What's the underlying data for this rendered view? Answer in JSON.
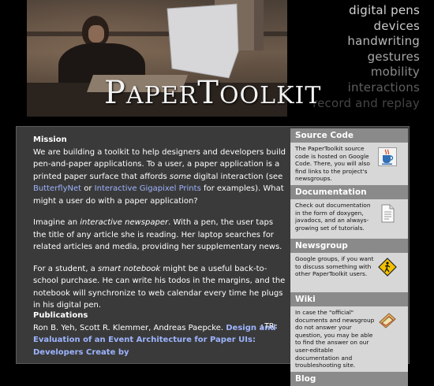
{
  "banner": {
    "logo_big_p": "P",
    "logo_small_aper": "APER",
    "logo_big_t": "T",
    "logo_small_oolkit": "OOLKIT",
    "topics": [
      {
        "label": "digital pens",
        "color": "#d2d2d2"
      },
      {
        "label": "devices",
        "color": "#c8c8c8"
      },
      {
        "label": "handwriting",
        "color": "#b8b8b8"
      },
      {
        "label": "gestures",
        "color": "#a8a8a8"
      },
      {
        "label": "mobility",
        "color": "#8c8c8c"
      },
      {
        "label": "interactions",
        "color": "#5e5e5e"
      },
      {
        "label": "record and replay",
        "color": "#454545"
      }
    ]
  },
  "main": {
    "mission_heading": "Mission",
    "mission_text_1": "We are building a toolkit to help designers and developers build pen-and-paper applications. To a user, a paper application is a printed paper surface that affords ",
    "mission_em": "some",
    "mission_text_2": " digital interaction (see ",
    "link_butterflynet": "ButterflyNet",
    "mission_text_3": " or ",
    "link_gigapixel": "Interactive Gigapixel Prints",
    "mission_text_4": " for examples). What might a user do with a paper application?",
    "para2_a": "Imagine an ",
    "para2_em": "interactive newspaper",
    "para2_b": ". With a pen, the user taps the title of any article she is reading. Her laptop searches for related articles and media, providing her supplementary news.",
    "para3_a": "For a student, a ",
    "para3_em": "smart notebook",
    "para3_b": " might be a useful back-to-school purchase. He can write his todos in the margins, and the notebook will synchronize to web calendar every time he plugs in his digital pen.",
    "publications_heading": "Publications",
    "pub_authors": "Ron B. Yeh, Scott R. Klemmer, Andreas Paepcke. ",
    "pub_title": "Design and Evaluation of an Event Architecture for Paper UIs: Developers Create by",
    "tr_mark": ":TR:"
  },
  "sidebar": {
    "sections": [
      {
        "title": "Source Code",
        "text": "The PaperToolkit source code is hosted on Google Code. There, you will also find links to the project's newsgroups.",
        "icon": "java-cup-icon"
      },
      {
        "title": "Documentation",
        "text": "Check out documentation in the form of doxygen, javadocs, and an always-growing set of tutorials.",
        "icon": "document-icon"
      },
      {
        "title": "Newsgroup",
        "text": "Google groups, if you want to discuss something with other PaperToolkit users.",
        "icon": "crossing-sign-icon"
      },
      {
        "title": "Wiki",
        "text": "In case the \"official\" documents and newsgroup do not answer your question, you may be able to find the answer on our user-editable documentation and troubleshooting site.",
        "icon": "sandwich-icon"
      },
      {
        "title": "Blog",
        "text": "",
        "icon": ""
      }
    ]
  },
  "colors": {
    "panel": "#3a3a3a",
    "sidebar_header": "#8a8a8a",
    "sidebar_body": "#d7d7d7",
    "link": "#9db4ff"
  }
}
